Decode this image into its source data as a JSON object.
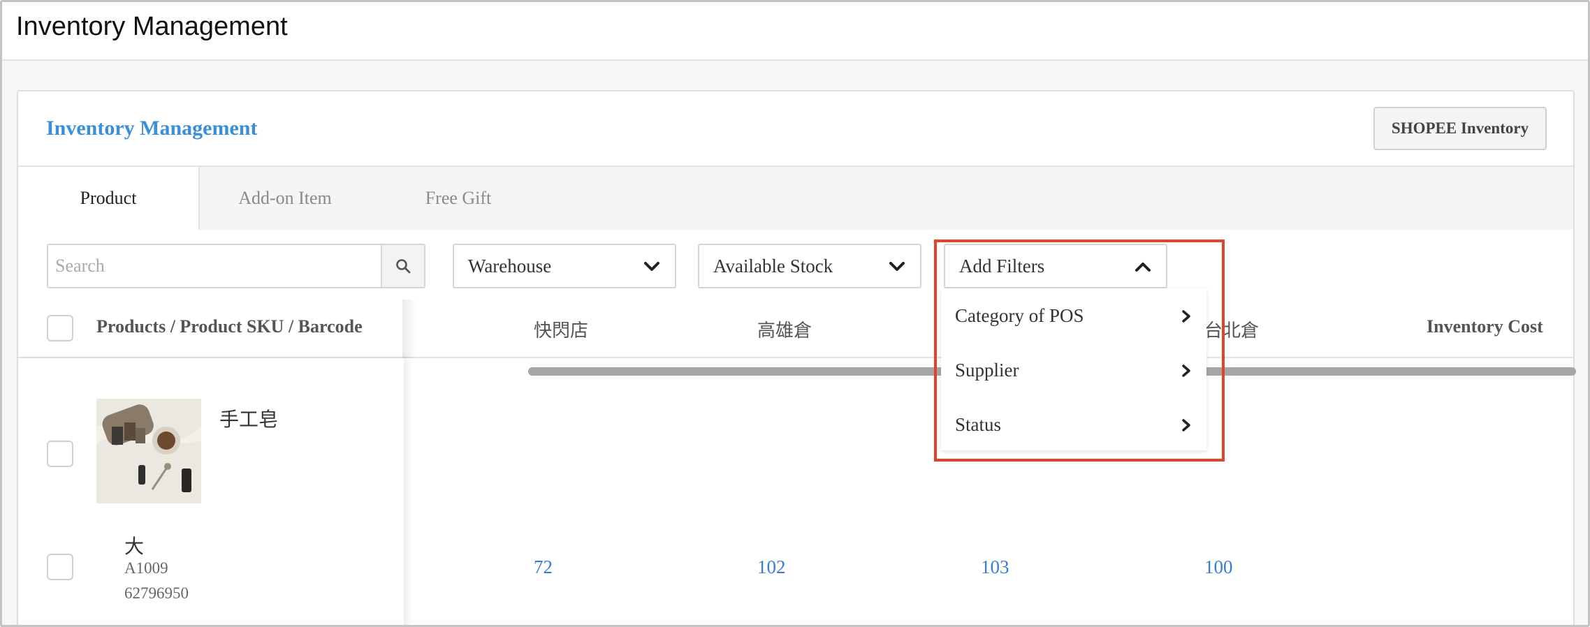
{
  "app": {
    "title": "Inventory Management"
  },
  "card": {
    "title": "Inventory Management",
    "shopee_button": "SHOPEE Inventory"
  },
  "tabs": [
    {
      "label": "Product",
      "active": true
    },
    {
      "label": "Add-on Item",
      "active": false
    },
    {
      "label": "Free Gift",
      "active": false
    }
  ],
  "toolbar": {
    "search_placeholder": "Search",
    "warehouse": "Warehouse",
    "stock": "Available Stock",
    "filters": "Add Filters"
  },
  "filters_menu": {
    "items": [
      "Category of POS",
      "Supplier",
      "Status"
    ]
  },
  "table": {
    "columns": [
      "Products / Product SKU / Barcode",
      "快閃店",
      "高雄倉",
      "台北倉",
      "Inventory Cost"
    ],
    "product": {
      "name": "手工皂",
      "variant": {
        "name": "大",
        "sku": "A1009",
        "barcode": "62796950",
        "quantities": [
          "72",
          "102",
          "103",
          "100"
        ]
      }
    }
  },
  "colors": {
    "accent": "#3a8fd9",
    "highlight": "#e0442b",
    "link": "#3a7bd5"
  },
  "icons": [
    "search-icon",
    "chevron-down-icon",
    "chevron-up-icon",
    "chevron-right-icon"
  ]
}
